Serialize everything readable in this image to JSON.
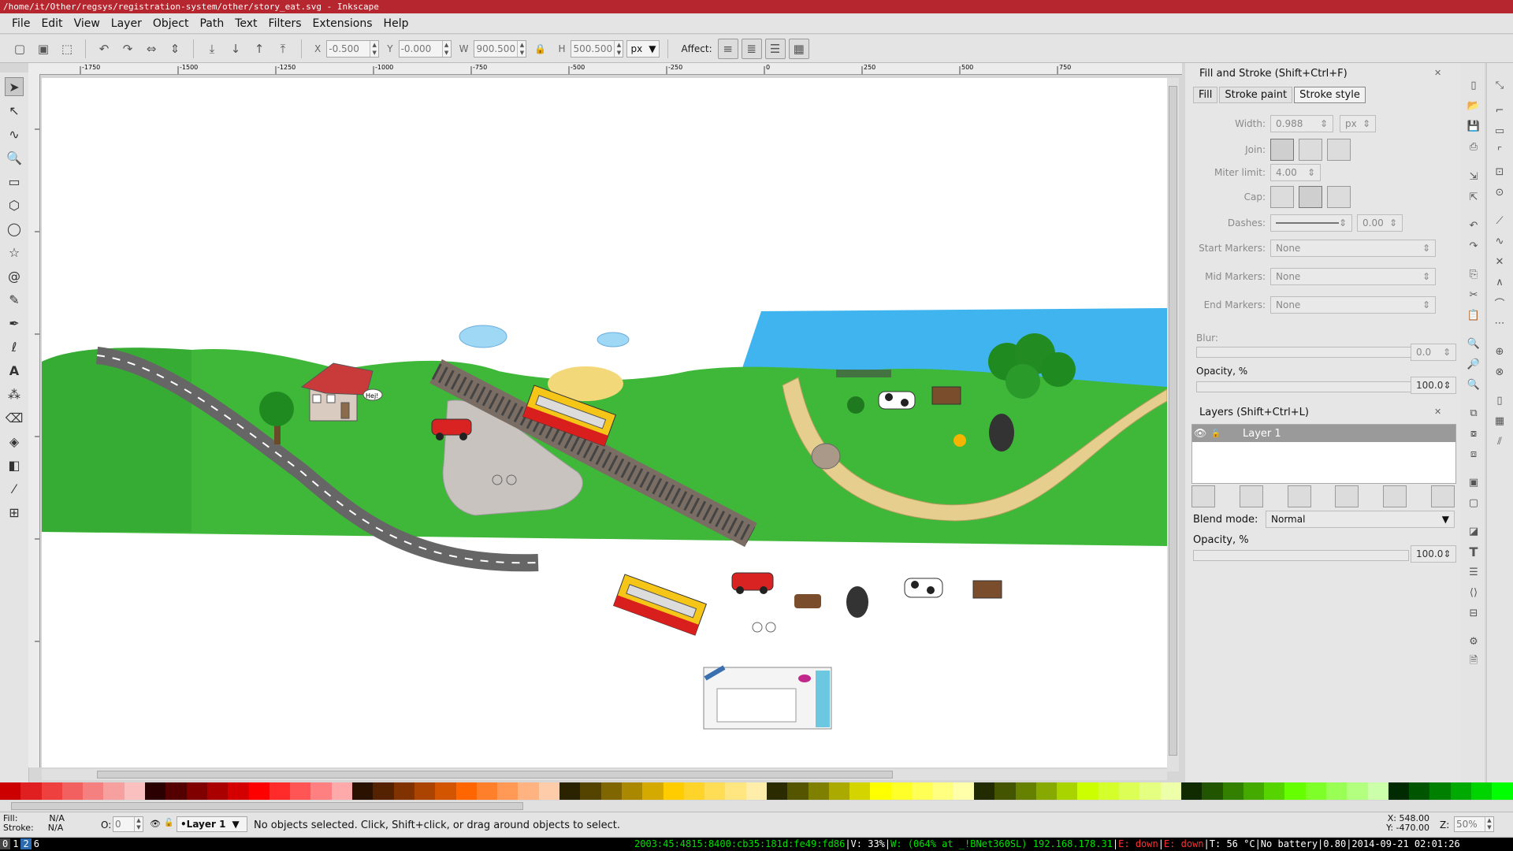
{
  "window": {
    "title": "/home/it/Other/regsys/registration-system/other/story_eat.svg - Inkscape"
  },
  "menu": [
    "File",
    "Edit",
    "View",
    "Layer",
    "Object",
    "Path",
    "Text",
    "Filters",
    "Extensions",
    "Help"
  ],
  "toolbar": {
    "x_label": "X",
    "x_value": "-0.500",
    "y_label": "Y",
    "y_value": "-0.000",
    "w_label": "W",
    "w_value": "900.500",
    "h_label": "H",
    "h_value": "500.500",
    "unit": "px",
    "affect_label": "Affect:"
  },
  "ruler": {
    "h_ticks": [
      "-1750",
      "-1500",
      "-1250",
      "-1000",
      "-750",
      "-500",
      "-250",
      "0",
      "250",
      "500",
      "750"
    ]
  },
  "fill_stroke": {
    "title": "Fill and Stroke (Shift+Ctrl+F)",
    "tabs": [
      "Fill",
      "Stroke paint",
      "Stroke style"
    ],
    "width_label": "Width:",
    "width_value": "0.988",
    "width_unit": "px",
    "join_label": "Join:",
    "miter_label": "Miter limit:",
    "miter_value": "4.00",
    "cap_label": "Cap:",
    "dashes_label": "Dashes:",
    "dashes_value": "0.00",
    "start_markers_label": "Start Markers:",
    "start_markers_value": "None",
    "mid_markers_label": "Mid Markers:",
    "mid_markers_value": "None",
    "end_markers_label": "End Markers:",
    "end_markers_value": "None",
    "blur_label": "Blur:",
    "blur_value": "0.0",
    "opacity_label": "Opacity, %",
    "opacity_value": "100.0"
  },
  "layers": {
    "title": "Layers (Shift+Ctrl+L)",
    "items": [
      "Layer 1"
    ],
    "blend_label": "Blend mode:",
    "blend_value": "Normal",
    "opacity_label": "Opacity, %",
    "opacity_value": "100.0"
  },
  "palette": [
    "#cc0000",
    "#e02020",
    "#ef4040",
    "#f26060",
    "#f48080",
    "#f7a0a0",
    "#fac0c0",
    "#2a0000",
    "#550000",
    "#800000",
    "#aa0000",
    "#d40000",
    "#ff0000",
    "#ff2a2a",
    "#ff5555",
    "#ff8080",
    "#ffaaaa",
    "#2b1100",
    "#552200",
    "#803300",
    "#aa4400",
    "#d45500",
    "#ff6600",
    "#ff7f2a",
    "#ff9955",
    "#ffb380",
    "#ffccaa",
    "#2b2200",
    "#554400",
    "#806600",
    "#aa8800",
    "#d4aa00",
    "#ffcc00",
    "#ffd42a",
    "#ffdd55",
    "#ffe680",
    "#ffeeaa",
    "#2b2b00",
    "#555500",
    "#808000",
    "#aaaa00",
    "#d4d400",
    "#ffff00",
    "#ffff2a",
    "#ffff55",
    "#ffff80",
    "#ffffaa",
    "#222b00",
    "#445500",
    "#668000",
    "#88aa00",
    "#aad400",
    "#ccff00",
    "#d4ff2a",
    "#ddff55",
    "#e5ff80",
    "#eeffaa",
    "#112b00",
    "#225500",
    "#338000",
    "#44aa00",
    "#55d400",
    "#66ff00",
    "#7fff2a",
    "#99ff55",
    "#b3ff80",
    "#ccffaa",
    "#002b00",
    "#005500",
    "#008000",
    "#00aa00",
    "#00d400",
    "#00ff00"
  ],
  "status": {
    "fill_label": "Fill:",
    "fill_value": "N/A",
    "stroke_label": "Stroke:",
    "stroke_value": "N/A",
    "o_label": "O:",
    "o_value": "0",
    "layer": "•Layer 1",
    "message": "No objects selected. Click, Shift+click, or drag around objects to select.",
    "x": "X: 548.00",
    "y": "Y: -470.00",
    "z_label": "Z:",
    "zoom": "50%"
  },
  "sysbar": {
    "workspaces": [
      "0",
      "1",
      "2",
      "6"
    ],
    "ipv6": "2003:45:4815:8400:cb35:181d:fe49:fd86",
    "vol": "V: 33%",
    "wifi": "W: (064% at _!BNet360SL) 192.168.178.31",
    "eth": "E: down",
    "eth2": "E: down",
    "temp": "T: 56 °C",
    "battery": "No battery",
    "load": "0.80",
    "datetime": "2014-09-21 02:01:26"
  },
  "canvas": {
    "sign_text": "Hej!"
  }
}
